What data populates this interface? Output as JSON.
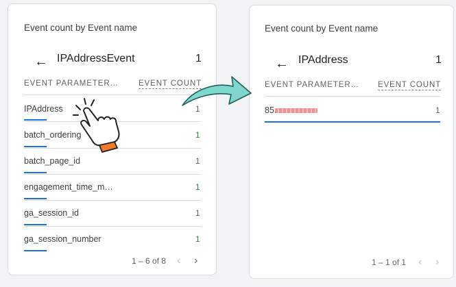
{
  "left_card": {
    "title": "Event count by Event name",
    "back_glyph": "←",
    "metric_name": "IPAddressEvent",
    "metric_value": "1",
    "col_param": "EVENT PARAMETER…",
    "col_count": "EVENT COUNT",
    "rows": [
      {
        "label": "IPAddress",
        "value": "1"
      },
      {
        "label": "batch_ordering",
        "value": "1"
      },
      {
        "label": "batch_page_id",
        "value": "1"
      },
      {
        "label": "engagement_time_m…",
        "value": "1"
      },
      {
        "label": "ga_session_id",
        "value": "1"
      },
      {
        "label": "ga_session_number",
        "value": "1"
      }
    ],
    "pager": "1 – 6 of 8",
    "prev_glyph": "‹",
    "next_glyph": "›"
  },
  "right_card": {
    "title": "Event count by Event name",
    "back_glyph": "←",
    "metric_name": "IPAddress",
    "metric_value": "1",
    "col_param": "EVENT PARAMETER…",
    "col_count": "EVENT COUNT",
    "rows": [
      {
        "label": "85.",
        "value": "1"
      }
    ],
    "pager": "1 – 1 of 1",
    "prev_glyph": "‹",
    "next_glyph": "›"
  },
  "icons": {
    "arrow": "curved-arrow-icon",
    "hand": "pointing-hand-icon"
  },
  "colors": {
    "accent_bar": "#1a73e8",
    "value_green": "#1e8e3e",
    "arrow_fill": "#7fd6cc",
    "hand_cuff": "#f07b2a"
  }
}
